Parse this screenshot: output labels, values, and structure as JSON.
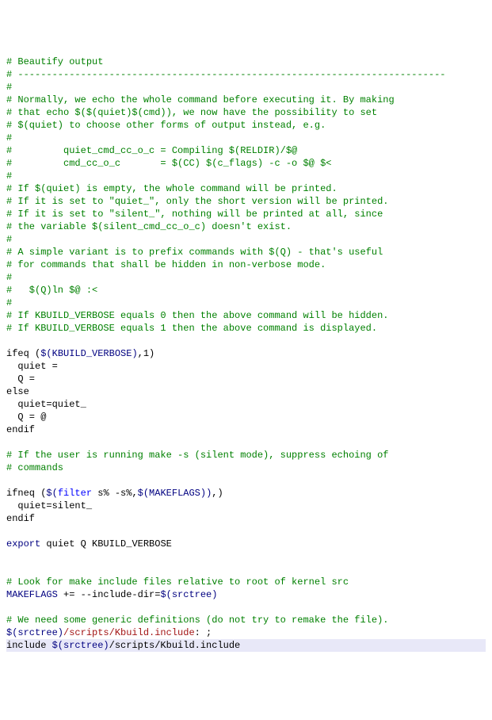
{
  "lines": {
    "l01": "# Beautify output",
    "l02": "# ---------------------------------------------------------------------------",
    "l03": "#",
    "l04": "# Normally, we echo the whole command before executing it. By making",
    "l05": "# that echo $($(quiet)$(cmd)), we now have the possibility to set",
    "l06": "# $(quiet) to choose other forms of output instead, e.g.",
    "l07": "#",
    "l08": "#         quiet_cmd_cc_o_c = Compiling $(RELDIR)/$@",
    "l09": "#         cmd_cc_o_c       = $(CC) $(c_flags) -c -o $@ $<",
    "l10": "#",
    "l11": "# If $(quiet) is empty, the whole command will be printed.",
    "l12": "# If it is set to \"quiet_\", only the short version will be printed.",
    "l13": "# If it is set to \"silent_\", nothing will be printed at all, since",
    "l14": "# the variable $(silent_cmd_cc_o_c) doesn't exist.",
    "l15": "#",
    "l16": "# A simple variant is to prefix commands with $(Q) - that's useful",
    "l17": "# for commands that shall be hidden in non-verbose mode.",
    "l18": "#",
    "l19": "#   $(Q)ln $@ :<",
    "l20": "#",
    "l21": "# If KBUILD_VERBOSE equals 0 then the above command will be hidden.",
    "l22": "# If KBUILD_VERBOSE equals 1 then the above command is displayed.",
    "ifeq": "ifeq (",
    "kbv": "$(KBUILD_VERBOSE)",
    "ifeq_tail": ",1)",
    "quiet_eq": "  quiet =",
    "Q_eq": "  Q =",
    "else": "else",
    "quiet_quiet": "  quiet=quiet_",
    "Q_at": "  Q = @",
    "endif": "endif",
    "cmt_silent1": "# If the user is running make -s (silent mode), suppress echoing of",
    "cmt_silent2": "# commands",
    "ifneq": "ifneq (",
    "filter_open": "$(",
    "filter_fn": "filter",
    "filter_args": " s% -s%,",
    "makeflags": "$(MAKEFLAGS)",
    "filter_close": ")",
    "ifneq_tail": ",)",
    "quiet_silent": "  quiet=silent_",
    "export": "export",
    "export_tail": " quiet Q KBUILD_VERBOSE",
    "cmt_look": "# Look for make include files relative to root of kernel src",
    "mf_lhs": "MAKEFLAGS",
    "mf_op": " += --include-dir=",
    "srctree": "$(srctree)",
    "cmt_need": "# We need some generic definitions (do not try to remake the file).",
    "rule_path_red": "/scripts/Kbuild.include",
    "rule_tail": ": ;",
    "include": "include ",
    "inc_path_tail": "/scripts/Kbuild.include"
  }
}
